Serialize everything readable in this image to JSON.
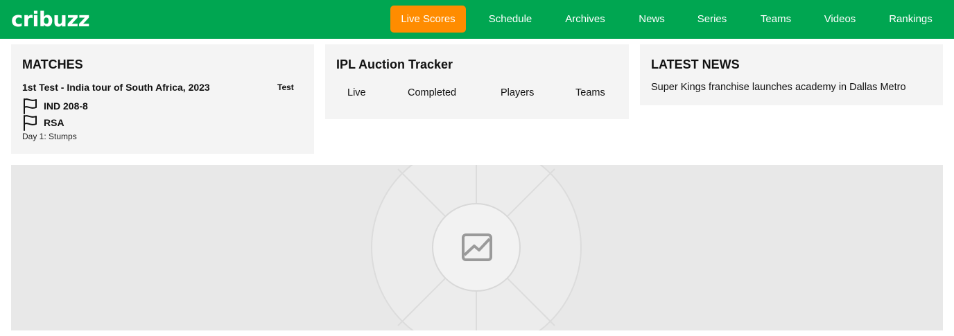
{
  "brand": {
    "logo_text": "cribuzz"
  },
  "nav": {
    "items": [
      {
        "label": "Live Scores"
      },
      {
        "label": "Schedule"
      },
      {
        "label": "Archives"
      },
      {
        "label": "News"
      },
      {
        "label": "Series"
      },
      {
        "label": "Teams"
      },
      {
        "label": "Videos"
      },
      {
        "label": "Rankings"
      }
    ],
    "active_color": "#ff8c00",
    "bar_color": "#00a651"
  },
  "matches": {
    "heading": "MATCHES",
    "match": {
      "title": "1st Test - India tour of South Africa, 2023",
      "format": "Test",
      "teams": [
        {
          "name": "IND 208-8",
          "icon": "flag-icon"
        },
        {
          "name": "RSA",
          "icon": "flag-icon"
        }
      ],
      "status": "Day 1: Stumps"
    }
  },
  "auction": {
    "heading": "IPL Auction Tracker",
    "tabs": [
      {
        "label": "Live"
      },
      {
        "label": "Completed"
      },
      {
        "label": "Players"
      },
      {
        "label": "Teams"
      }
    ]
  },
  "news": {
    "heading": "LATEST NEWS",
    "items": [
      {
        "headline": "Super Kings franchise launches academy in Dallas Metro"
      }
    ]
  },
  "hero": {
    "icon": "image-placeholder-icon"
  }
}
